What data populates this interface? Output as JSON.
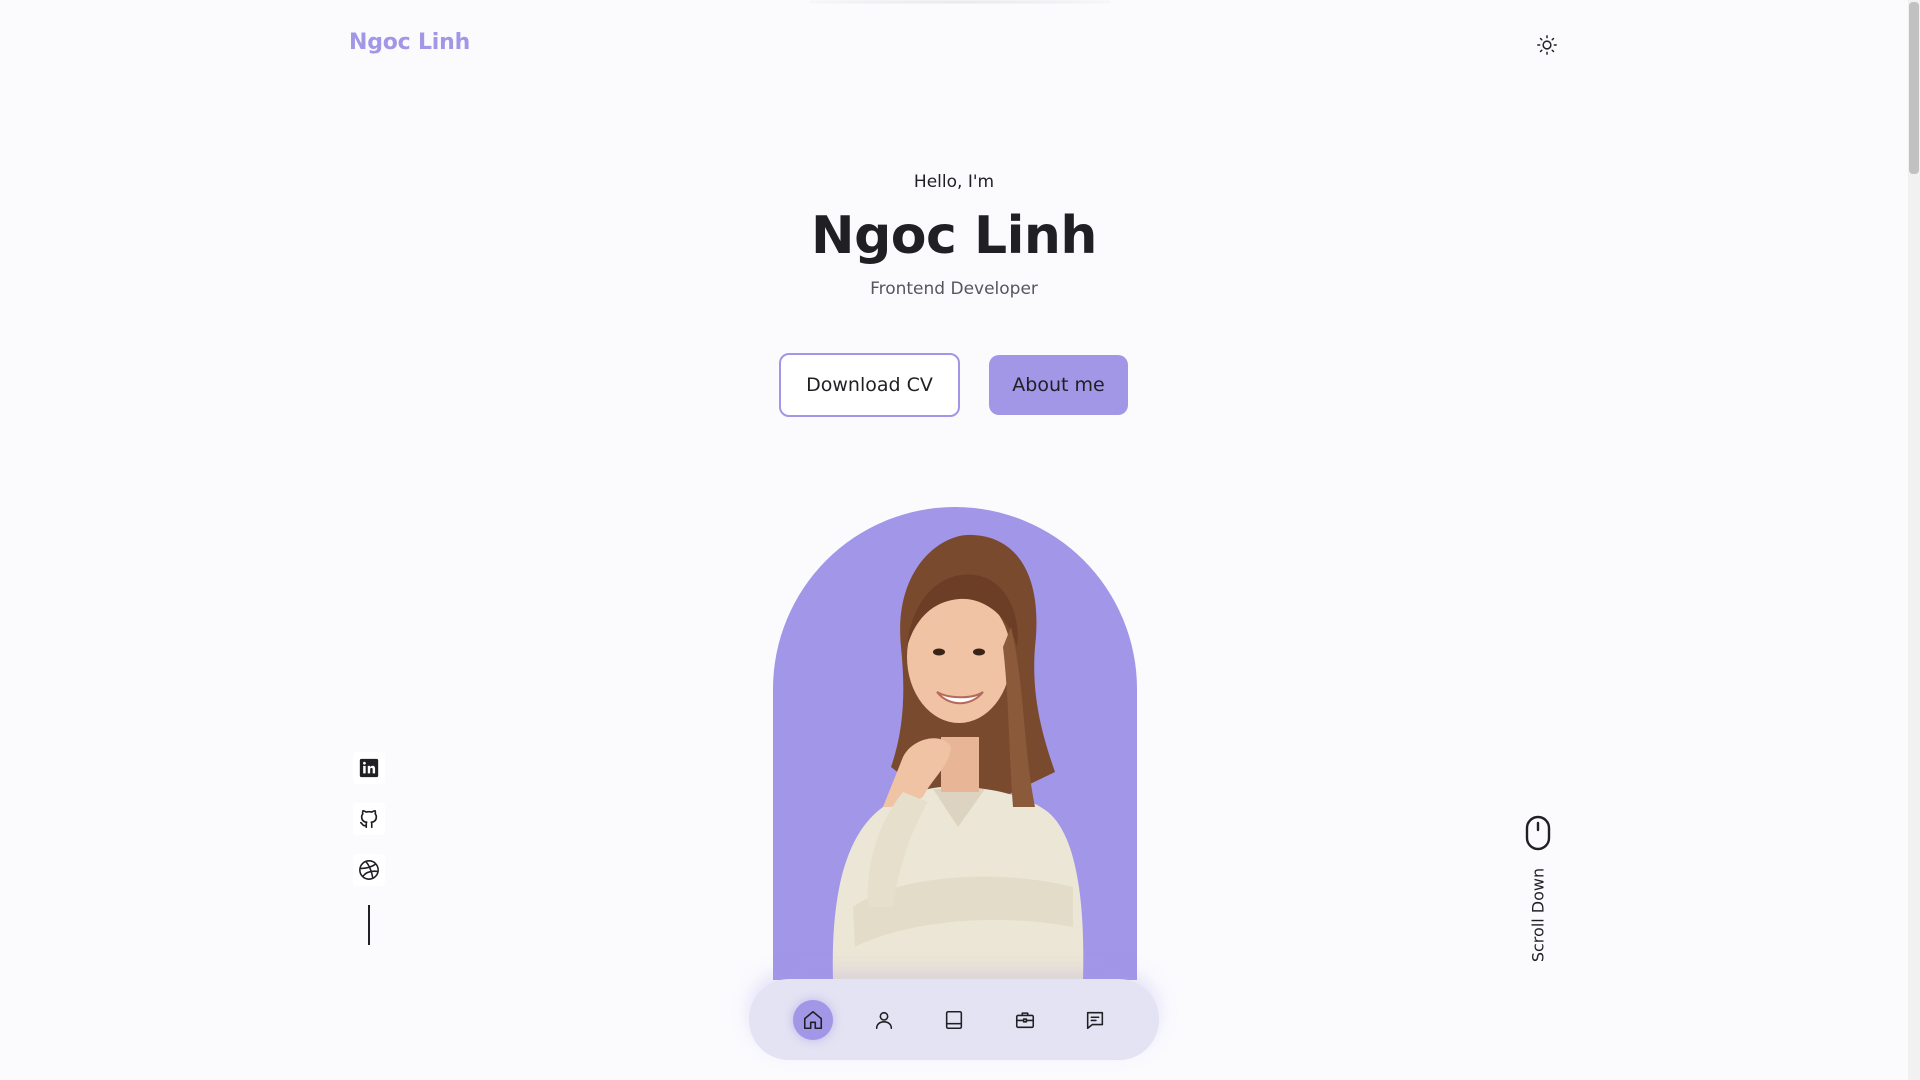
{
  "header": {
    "logo": "Ngoc Linh",
    "theme_icon": "sun-icon"
  },
  "hero": {
    "greeting": "Hello, I'm",
    "name": "Ngoc Linh",
    "role": "Frontend Developer",
    "download_label": "Download CV",
    "about_label": "About me"
  },
  "colors": {
    "accent": "#a296e6",
    "background": "#fbfbfe",
    "text": "#1f1f24",
    "nav_bg": "#e4e3f3"
  },
  "socials": [
    {
      "icon": "linkedin-icon"
    },
    {
      "icon": "github-icon"
    },
    {
      "icon": "dribbble-icon"
    }
  ],
  "scroll": {
    "label": "Scroll Down",
    "icon": "mouse-icon"
  },
  "bottom_nav": {
    "items": [
      {
        "icon": "home-icon",
        "active": true
      },
      {
        "icon": "user-icon",
        "active": false
      },
      {
        "icon": "book-icon",
        "active": false
      },
      {
        "icon": "briefcase-icon",
        "active": false
      },
      {
        "icon": "message-icon",
        "active": false
      }
    ]
  }
}
